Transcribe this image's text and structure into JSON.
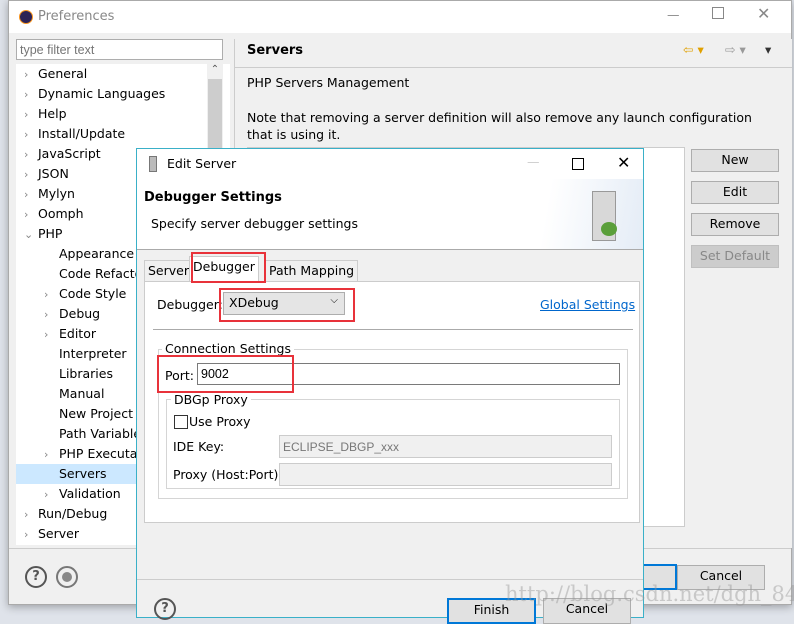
{
  "preferences": {
    "title": "Preferences",
    "filter_placeholder": "type filter text",
    "tree": [
      {
        "label": "General",
        "level": 0
      },
      {
        "label": "Dynamic Languages",
        "level": 0
      },
      {
        "label": "Help",
        "level": 0
      },
      {
        "label": "Install/Update",
        "level": 0
      },
      {
        "label": "JavaScript",
        "level": 0
      },
      {
        "label": "JSON",
        "level": 0
      },
      {
        "label": "Mylyn",
        "level": 0
      },
      {
        "label": "Oomph",
        "level": 0
      },
      {
        "label": "PHP",
        "level": 0,
        "expanded": true
      },
      {
        "label": "Appearance",
        "level": 1,
        "leaf": true
      },
      {
        "label": "Code Refactor",
        "level": 1,
        "leaf": true
      },
      {
        "label": "Code Style",
        "level": 1
      },
      {
        "label": "Debug",
        "level": 1
      },
      {
        "label": "Editor",
        "level": 1
      },
      {
        "label": "Interpreter",
        "level": 1,
        "leaf": true
      },
      {
        "label": "Libraries",
        "level": 1,
        "leaf": true
      },
      {
        "label": "Manual",
        "level": 1,
        "leaf": true
      },
      {
        "label": "New Project L",
        "level": 1,
        "leaf": true
      },
      {
        "label": "Path Variable",
        "level": 1,
        "leaf": true
      },
      {
        "label": "PHP Executab",
        "level": 1
      },
      {
        "label": "Servers",
        "level": 1,
        "leaf": true,
        "selected": true
      },
      {
        "label": "Validation",
        "level": 1
      },
      {
        "label": "Run/Debug",
        "level": 0
      },
      {
        "label": "Server",
        "level": 0
      }
    ],
    "page_title": "Servers",
    "section": "PHP Servers Management",
    "note": "Note that removing a server definition will also remove any launch configuration that is using it.",
    "buttons": {
      "new": "New",
      "edit": "Edit",
      "remove": "Remove",
      "set_default": "Set Default"
    },
    "cancel": "Cancel"
  },
  "dialog": {
    "title": "Edit Server",
    "header_title": "Debugger Settings",
    "header_desc": "Specify server debugger settings",
    "tabs": [
      "Server",
      "Debugger",
      "Path Mapping"
    ],
    "active_tab": "Debugger",
    "debugger_label": "Debugger:",
    "debugger_value": "XDebug",
    "global_settings": "Global Settings",
    "connection_group": "Connection Settings",
    "port_label": "Port:",
    "port_value": "9002",
    "proxy_group": "DBGp Proxy",
    "use_proxy": "Use Proxy",
    "use_proxy_checked": false,
    "ide_key_label": "IDE Key:",
    "ide_key_value": "ECLIPSE_DBGP_xxx",
    "proxy_label": "Proxy (Host:Port):",
    "proxy_value": "",
    "finish": "Finish",
    "cancel": "Cancel"
  },
  "watermark": "http://blog.csdn.net/dgh_84",
  "colors": {
    "highlight": "#e8323a",
    "link": "#0066cc",
    "accent": "#0078d7"
  }
}
